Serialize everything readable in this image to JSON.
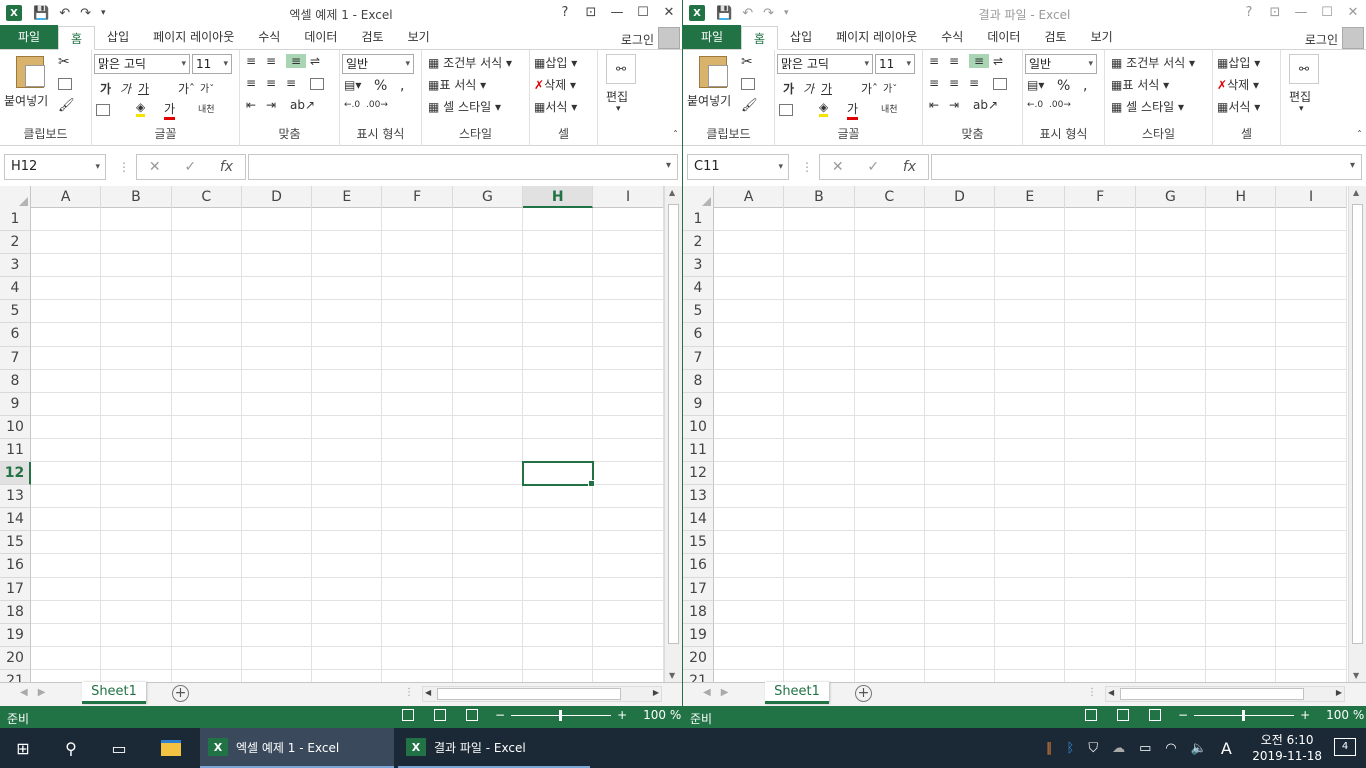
{
  "windows": [
    {
      "title": "엑셀 예제 1 - Excel",
      "app_icon": "X",
      "tabs": [
        "파일",
        "홈",
        "삽입",
        "페이지 레이아웃",
        "수식",
        "데이터",
        "검토",
        "보기"
      ],
      "login": "로그인",
      "ribbon": {
        "paste": "붙여넣기",
        "font_name": "맑은 고딕",
        "font_size": "11",
        "number_format": "일반",
        "conditional": "조건부 서식",
        "table_format": "표 서식",
        "cell_style": "셀 스타일",
        "insert": "삽입",
        "delete": "삭제",
        "format": "서식",
        "edit": "편집",
        "groups": [
          "클립보드",
          "글꼴",
          "맞춤",
          "표시 형식",
          "스타일",
          "셀"
        ]
      },
      "name_box": "H12",
      "columns": [
        "A",
        "B",
        "C",
        "D",
        "E",
        "F",
        "G",
        "H",
        "I"
      ],
      "rows": [
        "1",
        "2",
        "3",
        "4",
        "5",
        "6",
        "7",
        "8",
        "9",
        "10",
        "11",
        "12",
        "13",
        "14",
        "15",
        "16",
        "17",
        "18",
        "19",
        "20",
        "21"
      ],
      "selected_col": "H",
      "selected_row": "12",
      "sheet": "Sheet1",
      "status": "준비",
      "zoom": "100 %"
    },
    {
      "title": "결과 파일 - Excel",
      "app_icon": "X",
      "tabs": [
        "파일",
        "홈",
        "삽입",
        "페이지 레이아웃",
        "수식",
        "데이터",
        "검토",
        "보기"
      ],
      "login": "로그인",
      "ribbon": {
        "paste": "붙여넣기",
        "font_name": "맑은 고딕",
        "font_size": "11",
        "number_format": "일반",
        "conditional": "조건부 서식",
        "table_format": "표 서식",
        "cell_style": "셀 스타일",
        "insert": "삽입",
        "delete": "삭제",
        "format": "서식",
        "edit": "편집",
        "groups": [
          "클립보드",
          "글꼴",
          "맞춤",
          "표시 형식",
          "스타일",
          "셀"
        ]
      },
      "name_box": "C11",
      "columns": [
        "A",
        "B",
        "C",
        "D",
        "E",
        "F",
        "G",
        "H",
        "I"
      ],
      "rows": [
        "1",
        "2",
        "3",
        "4",
        "5",
        "6",
        "7",
        "8",
        "9",
        "10",
        "11",
        "12",
        "13",
        "14",
        "15",
        "16",
        "17",
        "18",
        "19",
        "20",
        "21"
      ],
      "selected_col": "",
      "selected_row": "",
      "sheet": "Sheet1",
      "status": "준비",
      "zoom": "100 %"
    }
  ],
  "taskbar": {
    "apps": [
      "엑셀 예제 1 - Excel",
      "결과 파일 - Excel"
    ],
    "ime": "A",
    "time": "오전 6:10",
    "date": "2019-11-18",
    "notifications": "4"
  },
  "colors": {
    "excel_green": "#217346",
    "taskbar": "#1b2836"
  }
}
